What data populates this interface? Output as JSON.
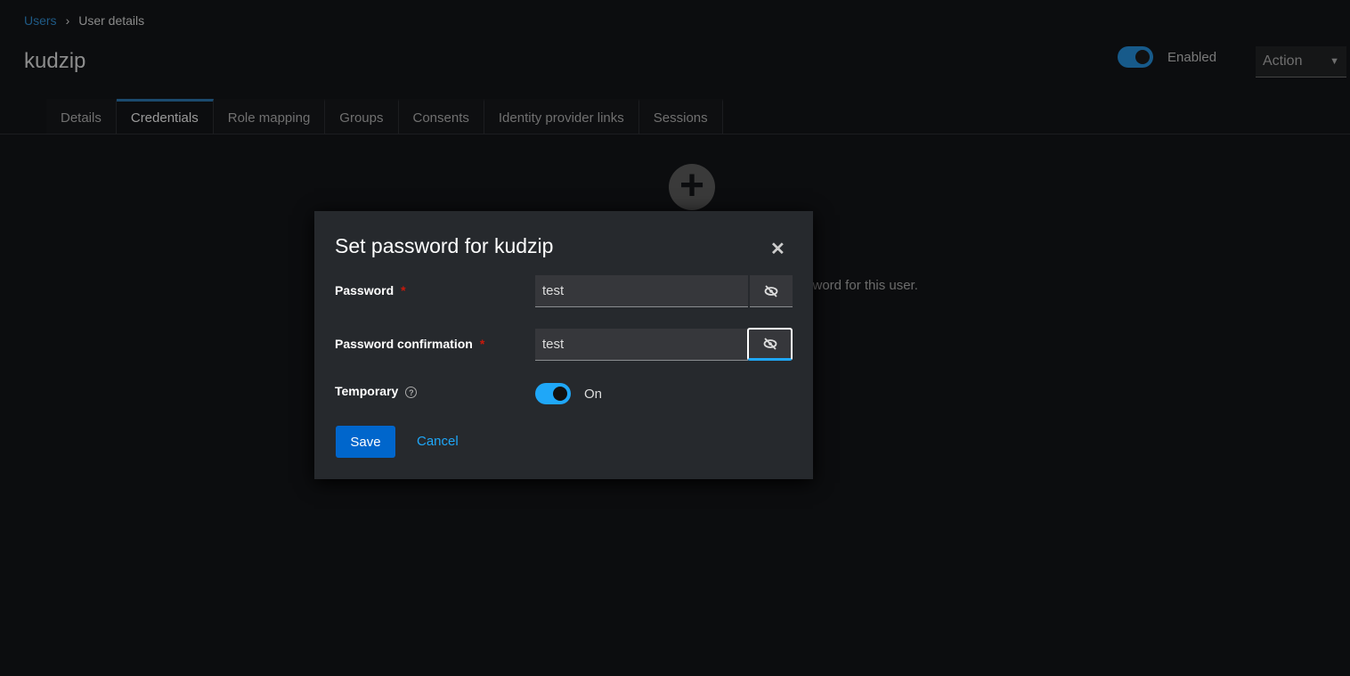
{
  "breadcrumb": {
    "parent": "Users",
    "current": "User details"
  },
  "page": {
    "title": "kudzip",
    "enabled_label": "Enabled",
    "enabled": true,
    "action_label": "Action"
  },
  "tabs": [
    {
      "label": "Details"
    },
    {
      "label": "Credentials",
      "active": true
    },
    {
      "label": "Role mapping"
    },
    {
      "label": "Groups"
    },
    {
      "label": "Consents"
    },
    {
      "label": "Identity provider links"
    },
    {
      "label": "Sessions"
    }
  ],
  "background": {
    "empty_text_fragment": "sword for this user."
  },
  "modal": {
    "title": "Set password for kudzip",
    "password_label": "Password",
    "password_value": "test",
    "confirm_label": "Password confirmation",
    "confirm_value": "test",
    "required_mark": "*",
    "temporary_label": "Temporary",
    "temporary_on": true,
    "temporary_state": "On",
    "save_label": "Save",
    "cancel_label": "Cancel"
  },
  "colors": {
    "primary": "#0066cc",
    "toggle": "#1fa7f8",
    "link": "#1fa7f8",
    "required": "#c9190b"
  }
}
